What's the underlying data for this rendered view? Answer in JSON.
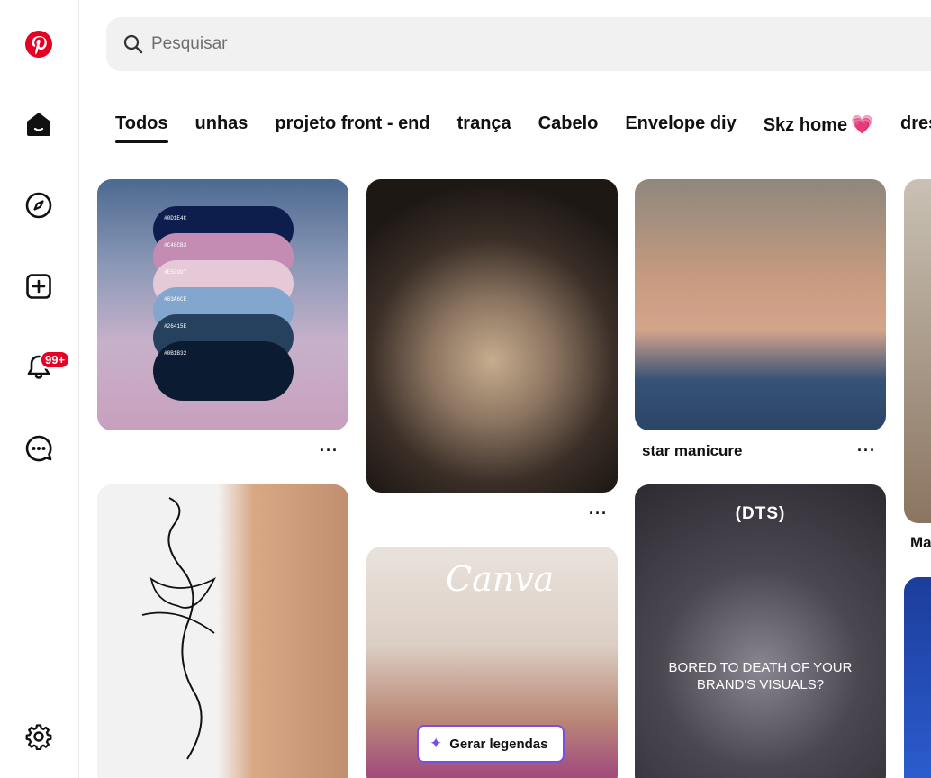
{
  "search": {
    "placeholder": "Pesquisar",
    "value": ""
  },
  "tabs": [
    {
      "label": "Todos",
      "active": true
    },
    {
      "label": "unhas"
    },
    {
      "label": "projeto front - end"
    },
    {
      "label": "trança"
    },
    {
      "label": "Cabelo"
    },
    {
      "label": "Envelope diy"
    },
    {
      "label": "Skz home",
      "emoji": "💗"
    },
    {
      "label": "dress?"
    }
  ],
  "sidebar": {
    "logo": "pinterest-logo",
    "items": [
      "home-icon",
      "explore-icon",
      "create-icon",
      "notifications-icon",
      "messages-icon",
      "settings-icon"
    ],
    "notification_count": "99+"
  },
  "palette": {
    "codes": [
      "#0D1E4C",
      "#C48CB3",
      "#E5C9D7",
      "#83A6CE",
      "#26415E",
      "#0B1B32"
    ],
    "colors": [
      "#0d1e4c",
      "#c48cb3",
      "#e5c9d7",
      "#83a6ce",
      "#26415e",
      "#0b1b32"
    ]
  },
  "pins": {
    "nails_title": "star manicure",
    "partial_title": "Ma",
    "canva_brand": "Canva",
    "canva_button": "Gerar legendas",
    "dts_brand": "(DTS)",
    "dts_text": "BORED TO DEATH OF YOUR BRAND'S VISUALS?",
    "more": "···"
  }
}
